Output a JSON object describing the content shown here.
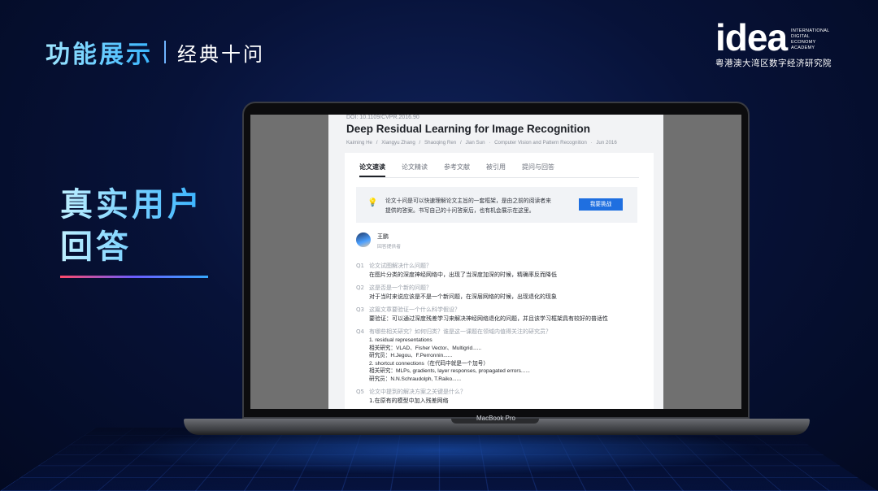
{
  "header": {
    "title": "功能展示",
    "subtitle": "经典十问"
  },
  "logo": {
    "word": "idea",
    "side": [
      "INTERNATIONAL",
      "DIGITAL",
      "ECONOMY",
      "ACADEMY"
    ],
    "cn": "粤港澳大湾区数字经济研究院"
  },
  "left_text": {
    "line1": "真实用户",
    "line2": "回答"
  },
  "laptop_label": "MacBook Pro",
  "paper": {
    "doi": "DOI: 10.1109/CVPR.2016.90",
    "title": "Deep Residual Learning for Image Recognition",
    "meta": [
      "Kaiming He",
      "/",
      "Xiangyu Zhang",
      "/",
      "Shaoqing Ren",
      "/",
      "Jian Sun",
      "·",
      "Computer Vision and Pattern Recognition",
      "·",
      "Jun 2016"
    ]
  },
  "tabs": [
    "论文速读",
    "论文精读",
    "参考文献",
    "被引用",
    "提问与回答"
  ],
  "notice": {
    "icon": "lightbulb-icon",
    "text": "论文十问是可以快速理解论文主旨的一套框架，是由之前的阅读者来提供的答案。书写自己的十问答案后，也有机会展示在这里。",
    "button": "我要挑战"
  },
  "answerer": {
    "name": "王鹏",
    "role": "回答提供者"
  },
  "qa": [
    {
      "num": "Q1",
      "q": "论文试图解决什么问题？",
      "a": "在图片分类的深度神经网络中，出现了当深度加深的时候，精确率反而降低"
    },
    {
      "num": "Q2",
      "q": "这是否是一个新的问题？",
      "a": "对于当时来说应该是不是一个新问题，在深层网络的时候，出现退化的现象"
    },
    {
      "num": "Q3",
      "q": "这篇文章要验证一个什么科学假设？",
      "a": "要验证：可以通过深度残差学习来解决神经网络退化的问题，并且该学习框架具有较好的普适性"
    },
    {
      "num": "Q4",
      "q": "有哪些相关研究？如何归类？谁是这一课题在领域内值得关注的研究员？",
      "lines": [
        "1. residual representations",
        "相关研究：VLAD、Fisher Vector、Multigrid......",
        "研究员：H.Jegou、F.Perronnin......",
        "2. shortcut connections（在代码中就是一个加号）",
        "相关研究：MLPs, gradients, layer responses, propagated errors......",
        "研究员：N.N.Schraudolph, T.Raiko......"
      ]
    },
    {
      "num": "Q5",
      "q": "论文中提到的解决方案之关键是什么？",
      "a": "1.在原有的模型中加入残差网络"
    }
  ],
  "colors": {
    "accent_blue": "#1f6fe0",
    "title_gradient_start": "#9fe6ff",
    "title_gradient_end": "#39b6ff"
  }
}
